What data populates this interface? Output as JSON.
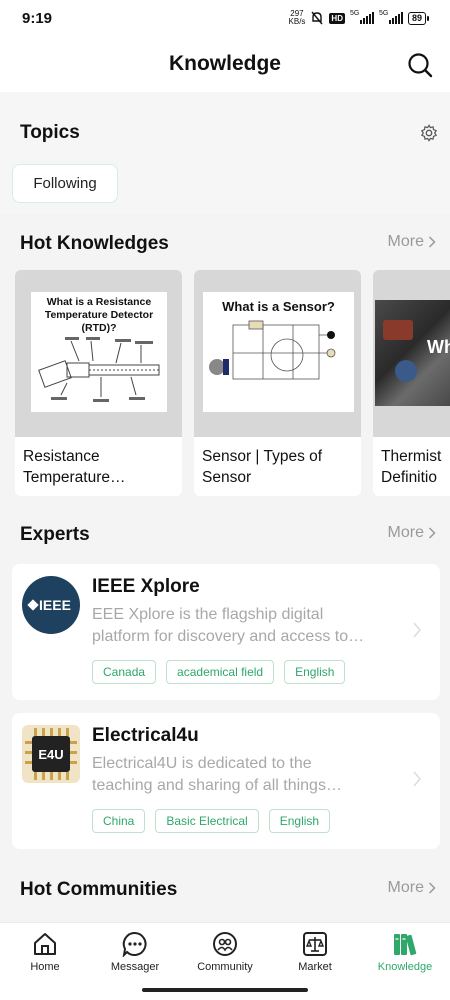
{
  "status_bar": {
    "time": "9:19",
    "net_speed_value": "297",
    "net_speed_unit": "KB/s",
    "hd_badge": "HD",
    "signal1_label": "5G",
    "signal2_label": "5G",
    "battery": "89"
  },
  "header": {
    "title": "Knowledge",
    "search_icon": "search-icon"
  },
  "topics": {
    "title": "Topics",
    "settings_icon": "gear-icon",
    "following_label": "Following"
  },
  "hot_knowledges": {
    "title": "Hot Knowledges",
    "more_label": "More",
    "cards": [
      {
        "image_title": "What is a Resistance Temperature Detector (RTD)?",
        "caption_line1": "Resistance",
        "caption_line2": "Temperature…"
      },
      {
        "image_title": "What is a Sensor?",
        "caption_line1": "Sensor | Types of",
        "caption_line2": "Sensor"
      },
      {
        "image_title": "Wh… a Ther…",
        "caption_line1": "Thermist",
        "caption_line2": "Definitio"
      }
    ]
  },
  "experts": {
    "title": "Experts",
    "more_label": "More",
    "items": [
      {
        "name": "IEEE Xplore",
        "logo_text": "IEEE",
        "desc_line1": "EEE Xplore is the flagship digital",
        "desc_line2": "platform for discovery and access to…",
        "tags": [
          "Canada",
          "academical field",
          "English"
        ]
      },
      {
        "name": "Electrical4u",
        "logo_text": "E4U",
        "desc_line1": "Electrical4U is dedicated to the",
        "desc_line2": "teaching and sharing of all things…",
        "tags": [
          "China",
          "Basic Electrical",
          "English"
        ]
      }
    ]
  },
  "hot_communities": {
    "title": "Hot Communities",
    "more_label": "More"
  },
  "tabbar": {
    "items": [
      {
        "label": "Home",
        "icon": "home-icon"
      },
      {
        "label": "Messager",
        "icon": "chat-icon"
      },
      {
        "label": "Community",
        "icon": "community-icon"
      },
      {
        "label": "Market",
        "icon": "market-icon"
      },
      {
        "label": "Knowledge",
        "icon": "books-icon"
      }
    ],
    "active": "Knowledge"
  },
  "colors": {
    "accent": "#2fa86a",
    "ieee_logo_bg": "#1f4160"
  }
}
